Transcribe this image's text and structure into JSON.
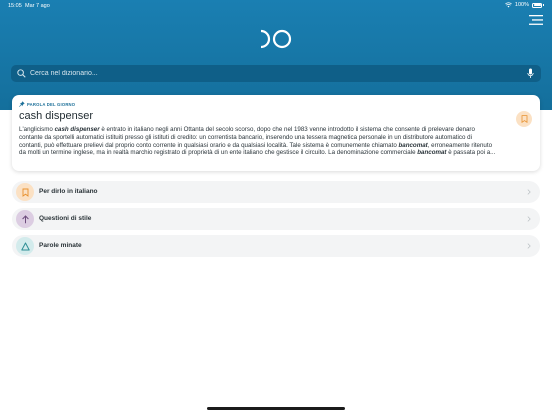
{
  "status_bar": {
    "time": "15:05",
    "date": "Mar 7 ago",
    "battery": "100%"
  },
  "search": {
    "placeholder": "Cerca nel dizionario..."
  },
  "word_of_day": {
    "label": "PAROLA DEL GIORNO",
    "title": "cash dispenser",
    "lines": [
      [
        "L'anglicismo ",
        "cash dispenser",
        " è entrato in italiano negli anni Ottanta del secolo scorso, dopo che nel 1983 venne introdotto il sistema che consente di prelevare denaro"
      ],
      [
        "contante da sportelli automatici istituiti presso gli istituti di credito: un correntista bancario, inserendo una tessera magnetica personale in un distributore automatico di"
      ],
      [
        "contanti, può effettuare prelievi dal proprio conto corrente in qualsiasi orario e da qualsiasi località. Tale sistema è comunemente chiamato ",
        "bancomat",
        ", erroneamente ritenuto"
      ],
      [
        "da molti un termine inglese, ma in realtà marchio registrato di proprietà di un ente italiano che gestisce il circuito. La denominazione commerciale ",
        "bancomat",
        " è passata poi a..."
      ]
    ]
  },
  "list_items": [
    {
      "label": "Per dirlo in italiano",
      "icon": "bookmark-icon",
      "bg": "#fbe1c4",
      "fg": "#e8912e"
    },
    {
      "label": "Questioni di stile",
      "icon": "arrow-up-icon",
      "bg": "#dccde2",
      "fg": "#6d4c7d"
    },
    {
      "label": "Parole minate",
      "icon": "warning-triangle-icon",
      "bg": "#d3ebec",
      "fg": "#2e8e94"
    }
  ],
  "colors": {
    "header": "#1878a8",
    "search_bg": "#0f5f88",
    "card_bg": "#ffffff",
    "list_bg": "#f3f4f5"
  }
}
